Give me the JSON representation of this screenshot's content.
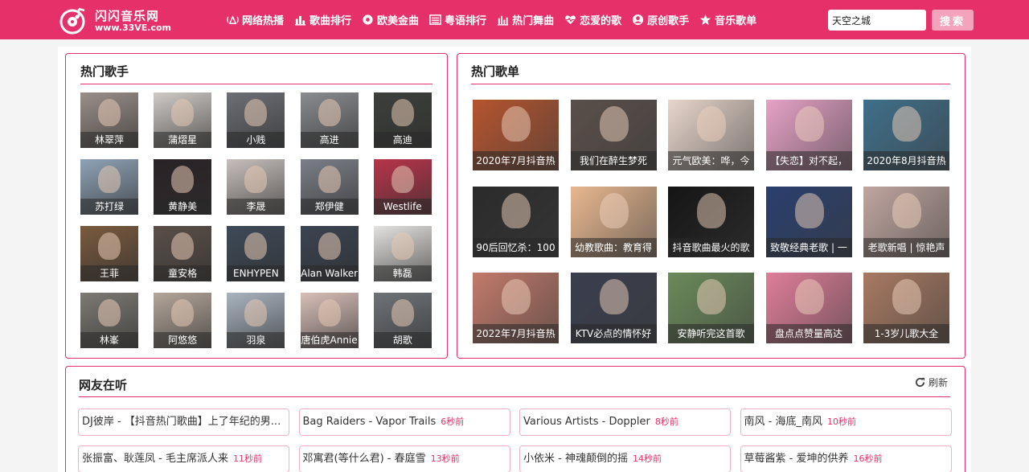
{
  "site": {
    "title": "闪闪音乐网",
    "url": "www.33VE.com",
    "accent": "#e6306a"
  },
  "nav": [
    {
      "label": "网络热播",
      "icon": "broadcast-icon"
    },
    {
      "label": "歌曲排行",
      "icon": "bar-chart-icon"
    },
    {
      "label": "欧美金曲",
      "icon": "gear-disc-icon"
    },
    {
      "label": "粤语排行",
      "icon": "list-icon"
    },
    {
      "label": "热门舞曲",
      "icon": "equalizer-icon"
    },
    {
      "label": "恋爱的歌",
      "icon": "heart-pulse-icon"
    },
    {
      "label": "原创歌手",
      "icon": "user-circle-icon"
    },
    {
      "label": "音乐歌单",
      "icon": "star-icon"
    }
  ],
  "search": {
    "value": "天空之城",
    "button": "搜索"
  },
  "hot_singers": {
    "title": "热门歌手",
    "items": [
      "林翠萍",
      "蒲熠星",
      "小贱",
      "高进",
      "高迪",
      "苏打绿",
      "黄静美",
      "李晟",
      "郑伊健",
      "Westlife",
      "王菲",
      "童安格",
      "ENHYPEN",
      "Alan Walker",
      "韩磊",
      "林峯",
      "阿悠悠",
      "羽泉",
      "唐伯虎Annie",
      "胡歌"
    ]
  },
  "hot_playlists": {
    "title": "热门歌单",
    "items": [
      "2020年7月抖音热",
      "我们在醉生梦死",
      "元气欧美：哗，今",
      "【失恋】对不起，",
      "2020年8月抖音热",
      "90后回忆杀：100",
      "幼教歌曲：教育得",
      "抖音歌曲最火的歌",
      "致敬经典老歌 | 一",
      "老歌新唱 | 惊艳声",
      "2022年7月抖音热",
      "KTV必点的情怀好",
      "安静听完这首歌",
      "盘点点赞量高达",
      "1-3岁儿歌大全"
    ]
  },
  "listening": {
    "title": "网友在听",
    "refresh": "刷新",
    "items": [
      {
        "text": "DJ彼岸 - 【抖音热门歌曲】上了年纪的男...",
        "time": ""
      },
      {
        "text": "Bag Raiders - Vapor Trails",
        "time": "6秒前"
      },
      {
        "text": "Various Artists - Doppler",
        "time": "8秒前"
      },
      {
        "text": "南风 - 海底_南风",
        "time": "10秒前"
      },
      {
        "text": "张振富、耿莲凤 - 毛主席派人来",
        "time": "11秒前"
      },
      {
        "text": "邓寓君(等什么君) - 春庭雪",
        "time": "13秒前"
      },
      {
        "text": "小依米 - 神魂颠倒的摇",
        "time": "14秒前"
      },
      {
        "text": "草莓酱紫 - 爱坤的供养",
        "time": "16秒前"
      }
    ]
  }
}
